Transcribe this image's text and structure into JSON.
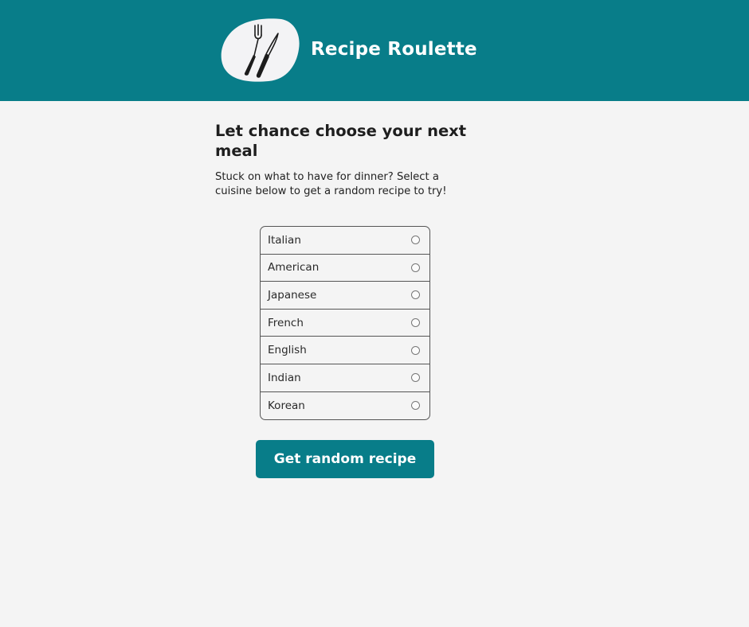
{
  "header": {
    "app_title": "Recipe Roulette",
    "logo_icon": "fork-and-knife-icon",
    "background_color": "#087d89"
  },
  "main": {
    "title": "Let chance choose your next meal",
    "intro": "Stuck on what to have for dinner? Select a cuisine below to get a random recipe to try!",
    "cuisines": [
      {
        "label": "Italian",
        "selected": false
      },
      {
        "label": "American",
        "selected": false
      },
      {
        "label": "Japanese",
        "selected": false
      },
      {
        "label": "French",
        "selected": false
      },
      {
        "label": "English",
        "selected": false
      },
      {
        "label": "Indian",
        "selected": false
      },
      {
        "label": "Korean",
        "selected": false
      }
    ],
    "cta_label": "Get random recipe"
  },
  "colors": {
    "accent": "#087d89",
    "background": "#f4f4f4",
    "text": "#1e1e1e"
  }
}
